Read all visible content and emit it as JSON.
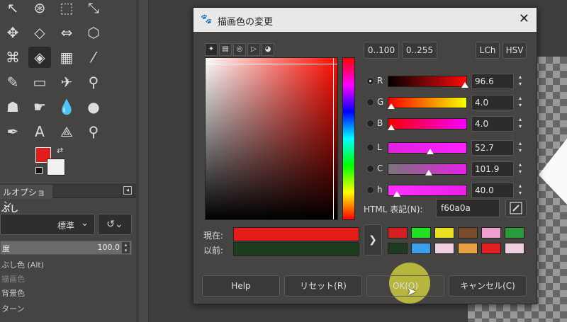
{
  "toolbox": {
    "tools": [
      {
        "name": "scale-tool-icon",
        "glyph": "↖"
      },
      {
        "name": "fuzzy-select-icon",
        "glyph": "⊛"
      },
      {
        "name": "crop-tool-icon",
        "glyph": "⬚"
      },
      {
        "name": "rotate-tool-icon",
        "glyph": "⤡"
      },
      {
        "name": "move-tool-icon",
        "glyph": "✥"
      },
      {
        "name": "perspective-tool-icon",
        "glyph": "◇"
      },
      {
        "name": "flip-tool-icon",
        "glyph": "⇔"
      },
      {
        "name": "cage-tool-icon",
        "glyph": "⬡"
      },
      {
        "name": "warp-tool-icon",
        "glyph": "⌘"
      },
      {
        "name": "bucket-fill-icon",
        "glyph": "◈"
      },
      {
        "name": "gradient-tool-icon",
        "glyph": "▦"
      },
      {
        "name": "paintbrush-icon",
        "glyph": "⁄"
      },
      {
        "name": "pencil-icon",
        "glyph": "✎"
      },
      {
        "name": "eraser-icon",
        "glyph": "▭"
      },
      {
        "name": "airbrush-icon",
        "glyph": "✈"
      },
      {
        "name": "clone-tool-icon",
        "glyph": "⚲"
      },
      {
        "name": "heal-tool-icon",
        "glyph": "☗"
      },
      {
        "name": "smudge-tool-icon",
        "glyph": "☛"
      },
      {
        "name": "blur-tool-icon",
        "glyph": "💧"
      },
      {
        "name": "dodge-burn-icon",
        "glyph": "●"
      },
      {
        "name": "paths-tool-icon",
        "glyph": "✒"
      },
      {
        "name": "text-tool-icon",
        "glyph": "A"
      },
      {
        "name": "measure-tool-icon",
        "glyph": "⟁"
      },
      {
        "name": "zoom-tool-icon",
        "glyph": "⚲"
      }
    ],
    "tool_options_tab": "ルオプション",
    "options_title": "ぶし",
    "mode_value": "標準",
    "opacity_label": "度",
    "opacity_value": "100.0",
    "option_lines": [
      "ぶし色 (Alt)",
      "描画色",
      "背景色",
      "ターン"
    ]
  },
  "dialog": {
    "title": "描画色の変更",
    "range_buttons": [
      "0..100",
      "0..255"
    ],
    "model_buttons": [
      "LCh",
      "HSV"
    ],
    "channels": [
      {
        "label": "R",
        "value": "96.6",
        "fraction": 0.966,
        "selected": true,
        "gradient": "linear-gradient(to right, #000, #ff0a0a)"
      },
      {
        "label": "G",
        "value": "4.0",
        "fraction": 0.04,
        "selected": false,
        "gradient": "linear-gradient(to right, #f60000, #f6ff00)"
      },
      {
        "label": "B",
        "value": "4.0",
        "fraction": 0.04,
        "selected": false,
        "gradient": "linear-gradient(to right, #f60000, #f600ff)"
      },
      {
        "label": "L",
        "value": "52.7",
        "fraction": 0.527,
        "selected": false,
        "gradient": "linear-gradient(to right, #e020e0, #ff20ff)"
      },
      {
        "label": "C",
        "value": "101.9",
        "fraction": 0.51,
        "selected": false,
        "gradient": "linear-gradient(to right, #777, #e820e8)"
      },
      {
        "label": "h",
        "value": "40.0",
        "fraction": 0.11,
        "selected": false,
        "gradient": "linear-gradient(to right, #ff30ff, #e820e8)"
      }
    ],
    "html_label": "HTML 表記(N):",
    "html_value": "f60a0a",
    "current_label": "現在:",
    "previous_label": "以前:",
    "current_color": "#e31e1a",
    "previous_color": "#1e3d1f",
    "history_colors": [
      "#d42020",
      "#22e022",
      "#e8e020",
      "#7a4a2a",
      "#f0a0d0",
      "#2a9a3a",
      "#1e3a20",
      "#3aa0e8",
      "#f0d0e0",
      "#e8a040",
      "#e02020",
      "#f0d0e0"
    ],
    "buttons": {
      "help": "Help",
      "reset": "リセット(R)",
      "ok": "OK(O)",
      "cancel": "キャンセル(C)"
    }
  }
}
